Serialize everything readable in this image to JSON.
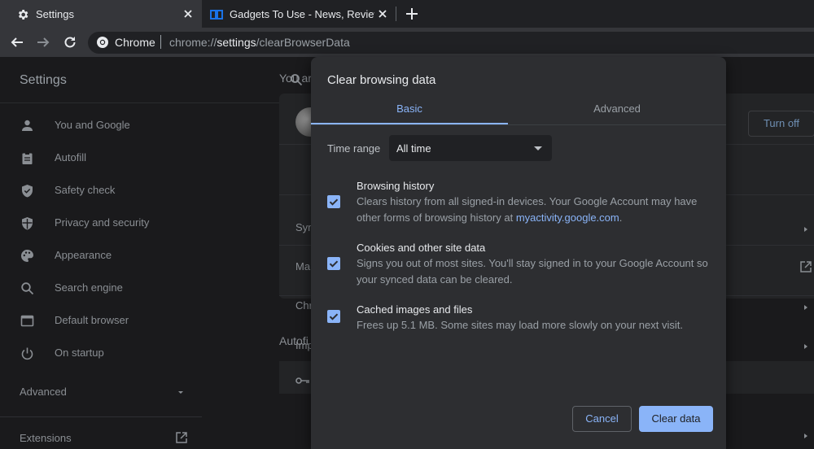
{
  "tabs": {
    "active": {
      "title": "Settings",
      "icon": "gear-icon"
    },
    "inactive": {
      "title": "Gadgets To Use - News, Reviews, Tip",
      "icon": "gadgets-favicon"
    }
  },
  "omnibox": {
    "site_label": "Chrome",
    "url_scheme": "chrome://",
    "url_host": "settings",
    "url_path": "/clearBrowserData"
  },
  "settings": {
    "title": "Settings",
    "sidebar": [
      {
        "label": "You and Google",
        "icon": "person-icon"
      },
      {
        "label": "Autofill",
        "icon": "clipboard-icon"
      },
      {
        "label": "Safety check",
        "icon": "shield-check-icon"
      },
      {
        "label": "Privacy and security",
        "icon": "shield-icon"
      },
      {
        "label": "Appearance",
        "icon": "palette-icon"
      },
      {
        "label": "Search engine",
        "icon": "search-icon"
      },
      {
        "label": "Default browser",
        "icon": "browser-icon"
      },
      {
        "label": "On startup",
        "icon": "power-icon"
      }
    ],
    "advanced": "Advanced",
    "extensions": "Extensions",
    "main": {
      "section_heading": "You ar",
      "turn_off": "Turn off",
      "rows": [
        "Syn",
        "Ma",
        "Chr",
        "Imp"
      ],
      "autofill_heading": "Autofi"
    }
  },
  "dialog": {
    "title": "Clear browsing data",
    "tabs": {
      "basic": "Basic",
      "advanced": "Advanced"
    },
    "time_range": {
      "label": "Time range",
      "value": "All time"
    },
    "options": [
      {
        "title": "Browsing history",
        "desc_line1": "Clears history from all signed-in devices. Your Google Account may have",
        "desc_line2_prefix": "other forms of browsing history at ",
        "desc_link": "myactivity.google.com",
        "desc_line2_suffix": ".",
        "checked": true
      },
      {
        "title": "Cookies and other site data",
        "desc_line1": "Signs you out of most sites. You'll stay signed in to your Google Account so",
        "desc_line2": "your synced data can be cleared.",
        "checked": true
      },
      {
        "title": "Cached images and files",
        "desc_line1": "Frees up 5.1 MB. Some sites may load more slowly on your next visit.",
        "checked": true
      }
    ],
    "buttons": {
      "cancel": "Cancel",
      "clear": "Clear data"
    }
  },
  "colors": {
    "accent": "#8ab4f8",
    "dialog_bg": "#2d2e31",
    "page_bg": "#202124"
  }
}
